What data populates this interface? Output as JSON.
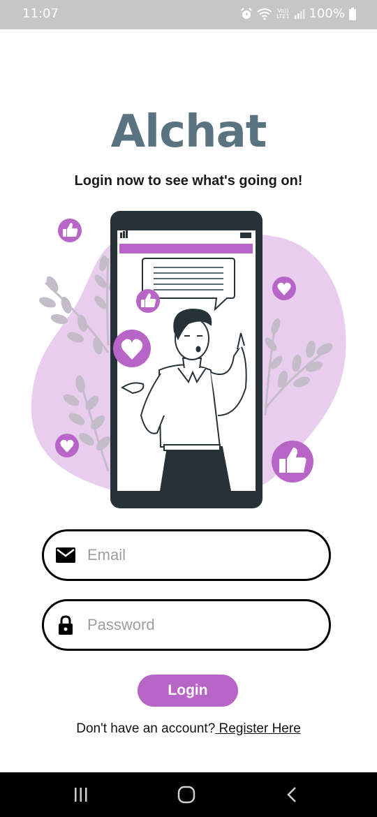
{
  "status_bar": {
    "time": "11:07",
    "network_label_top": "Vo))",
    "network_label_bottom": "LTE1",
    "battery": "100%"
  },
  "app": {
    "title": "Alchat",
    "subtitle": "Login now to see what's going on!"
  },
  "form": {
    "email_placeholder": "Email",
    "password_placeholder": "Password",
    "login_label": "Login",
    "register_prompt": "Don't have an account?",
    "register_link": " Register Here"
  },
  "icons": {
    "email": "envelope-icon",
    "password": "lock-icon",
    "nav_recents": "recents-icon",
    "nav_home": "home-icon",
    "nav_back": "back-icon"
  },
  "colors": {
    "accent": "#b865c8",
    "title": "#5a7381",
    "blob": "#e9cdee",
    "phone": "#263238"
  }
}
